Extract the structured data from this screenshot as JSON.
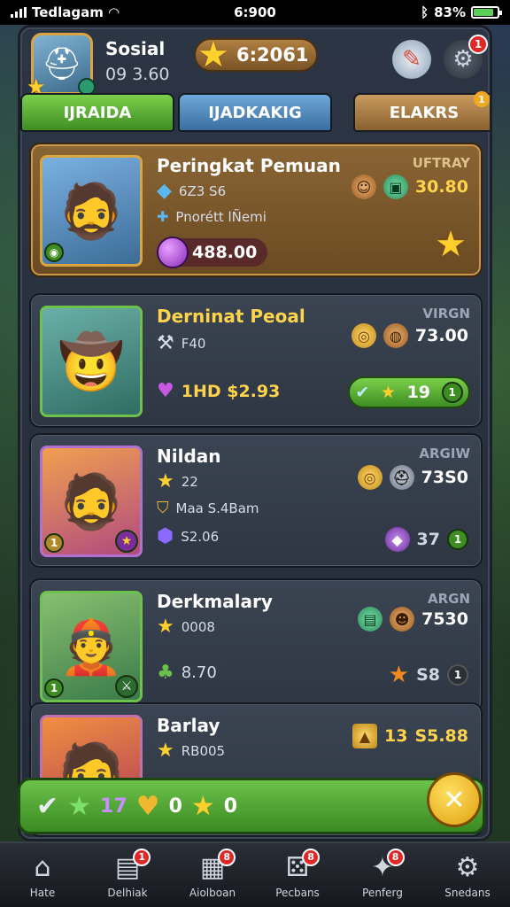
{
  "status": {
    "carrier": "Tedlagam",
    "time": "6:900",
    "battery": "83%",
    "battery_level": 0.83
  },
  "header": {
    "player_name": "Sosial",
    "player_sub": "09 3.60",
    "coins": "6:2061",
    "gear_badge": "1"
  },
  "tabs": [
    {
      "label": "IJRAIDA",
      "badge": ""
    },
    {
      "label": "IJADKAKIG",
      "badge": ""
    },
    {
      "label": "ELAKRS",
      "badge": "1"
    }
  ],
  "cards": [
    {
      "title": "Peringkat Pemuan",
      "tag": "UFTRAY",
      "line1": "6Z3 S6",
      "line2": "Pnorétt lÑemi",
      "pill": "488.00",
      "right_value": "30.80"
    },
    {
      "title": "Derninat Peoal",
      "tag": "VIRGN",
      "line1": "F40",
      "line2": "1HD $2.93",
      "right_value": "73.00",
      "green_pill": "19"
    },
    {
      "title": "Nildan",
      "tag": "ARGIW",
      "line1": "22",
      "line2": "Maa S.4Bam",
      "line3": "S2.06",
      "right_value": "73S0",
      "right_small": "37"
    },
    {
      "title": "Derkmalary",
      "tag": "ARGN",
      "line1": "0008",
      "line3": "8.70",
      "right_value": "7530",
      "right_small": "S8"
    },
    {
      "title": "Barlay",
      "line1": "RB005",
      "right_small": "13",
      "right_value": "S5.88"
    }
  ],
  "action_bar": {
    "count_star": "17",
    "count_heart": "0",
    "count_gold": "0"
  },
  "nav": [
    {
      "label": "Hate",
      "icon": "home-icon",
      "badge": ""
    },
    {
      "label": "Delhiak",
      "icon": "clipboard-icon",
      "badge": "1"
    },
    {
      "label": "Aiolboan",
      "icon": "grid-icon",
      "badge": "8"
    },
    {
      "label": "Pecbans",
      "icon": "dice-icon",
      "badge": "8"
    },
    {
      "label": "Penferg",
      "icon": "badge-icon",
      "badge": "8"
    },
    {
      "label": "Snedans",
      "icon": "gear-icon",
      "badge": ""
    }
  ]
}
